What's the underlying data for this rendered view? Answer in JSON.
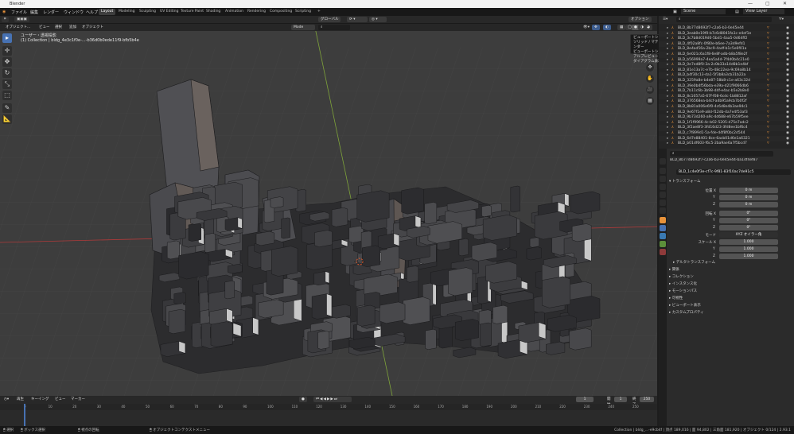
{
  "window": {
    "title": "Blender",
    "controls": [
      "—",
      "▢",
      "✕"
    ]
  },
  "menu": [
    "ファイル",
    "編集",
    "レンダー",
    "ウィンドウ",
    "ヘルプ"
  ],
  "workspaces": [
    {
      "label": "Layout",
      "active": true
    },
    {
      "label": "Modeling"
    },
    {
      "label": "Sculpting"
    },
    {
      "label": "UV Editing"
    },
    {
      "label": "Texture Paint"
    },
    {
      "label": "Shading"
    },
    {
      "label": "Animation"
    },
    {
      "label": "Rendering"
    },
    {
      "label": "Compositing"
    },
    {
      "label": "Scripting"
    },
    {
      "label": "+"
    }
  ],
  "topbar_right": {
    "scene": "Scene",
    "view_layer": "View Layer"
  },
  "viewport_header": {
    "mode": "オブジェクト...",
    "menus": [
      "ビュー",
      "選択",
      "追加",
      "オブジェクト"
    ],
    "orientation": "グローバル",
    "snap": "",
    "options_label": "オプション"
  },
  "viewport_header2": {
    "mode_label": "Mode",
    "search_placeholder": ""
  },
  "viewport_info": {
    "line1": "ユーザー・透視投影",
    "line2": "(1) Collection | bldg_4e3c1f0e-...-b36d0b0ede11f9-bfb5b4e"
  },
  "shading_popup": {
    "lines": [
      "ビューポートシェーディング",
      "ソリッド / マテリアルプレビュー / レンダー",
      "ビューポートシェーディング：マテリアルプレビュー",
      "ダイアグラム表示"
    ]
  },
  "tools": [
    "▸",
    "✛",
    "✥",
    "↻",
    "⤡",
    "⬚",
    "✎",
    "📐"
  ],
  "gizmo": [
    "✥",
    "✋",
    "🎥",
    "▦"
  ],
  "outliner": {
    "search_placeholder": "",
    "rows": [
      "BLD_8b77d8692f7-c2a6-b3-0e45e44",
      "BLD_3eab0e19f0-b7c6d8041fa1c-e4ef1e",
      "BLD_3c7b8d019d0-5bd1-4aa5-0d64ff2",
      "BLD_4f02a8fc-0f80e-b6ee-7a3d9efd1",
      "BLD_8e4ad56a-2bc9-4adf-b1c5e6f01a",
      "BLD_6e021c6a1f8-6e8f-adb-b8a5f8e2f",
      "BLD_b56999a7-4ea5a4d-7f4d0b4c21e0",
      "BLD_0e7ed8f0-3a-2c0b33a14d8b1e4bf",
      "BLD_81e13a7c-e7b-48c22ea-9c69a8b14",
      "BLD_b4f30c13-da1-5f3b8a3cb31b22a",
      "BLD_3259a8e-b4e87-58b8-c1e-a63c32d",
      "BLD_39e0b4f56bda-e39a-d21f9066db6",
      "BLD_7b11c6b-3b98-d4f-e4ac-b5e2b8e0",
      "BLD_8c1057a5-67f-f08-6cdc-1b8812af",
      "BLD_376568ea-b4cf-a4b95a9cb7b0f2f",
      "BLD_8b81a006e6f0-4c6d8e4b3ae94c1",
      "BLD_9e67f1e9-a8d-f12db-4a7e4f53af3",
      "BLD_9b73d260-a9c-4d688-e67b59f5ee",
      "BLD_1f1f9966-4c-b02-5205-d75e7adc2",
      "BLD_3f2ae8f3-3fd16d23-3fd8ee1bf6c4",
      "BLD_c7f899d1-5a-fde-d4f8f0bc2d544",
      "BLD_6d7e88401-8ce-6acb01d6e1a6321",
      "BLD_b01df603-f6c5-2ba9ae6a7f5bcd7"
    ]
  },
  "properties": {
    "object_path": "BLD_8b77d8692f7-c2a6-b3-0e45e44-ba1df4ef87",
    "object_name": "BLD_1c4e0f3e-cf7c-9f81-83f10ac7de91c5",
    "transform_title": "トランスフォーム",
    "location_label": "位置 X",
    "location": [
      "0 m",
      "0 m",
      "0 m"
    ],
    "rotation_label": "回転 X",
    "rotation": [
      "0°",
      "0°",
      "0°"
    ],
    "rotation_mode_label": "モード",
    "rotation_mode": "XYZ オイラー角",
    "scale_label": "スケール X",
    "scale": [
      "1.000",
      "1.000",
      "1.000"
    ],
    "axis_labels": [
      "Y",
      "Z",
      "Y",
      "Z",
      "Y",
      "Z"
    ],
    "sections": [
      "デルタトランスフォーム",
      "関係",
      "コレクション",
      "インスタンス化",
      "モーションパス",
      "可視性",
      "ビューポート表示",
      "カスタムプロパティ"
    ]
  },
  "timeline": {
    "menus": [
      "再生",
      "キーイング",
      "ビュー",
      "マーカー"
    ],
    "current_frame": "1",
    "start_label": "開始",
    "start": "1",
    "end_label": "終了",
    "end": "250",
    "ticks": [
      "0",
      "10",
      "20",
      "30",
      "40",
      "50",
      "60",
      "70",
      "80",
      "90",
      "100",
      "110",
      "120",
      "130",
      "140",
      "150",
      "160",
      "170",
      "180",
      "190",
      "200",
      "210",
      "220",
      "230",
      "240",
      "250"
    ]
  },
  "statusbar": {
    "left": [
      "選択",
      "ボックス選択",
      "視点の回転",
      "オブジェクトコンテクストメニュー"
    ],
    "right": "Collection | bldg_...-e9cb4f | 頂点 189,016 | 面 94,802 | 三角面 181,920 | オブジェクト 0/124 | 2.93.1"
  },
  "colors": {
    "accent": "#4772b3",
    "viewport_bg": "#3d3d3d",
    "x_axis": "#b03a3a",
    "y_axis": "#7ea33a",
    "arrow": "#e02020"
  }
}
